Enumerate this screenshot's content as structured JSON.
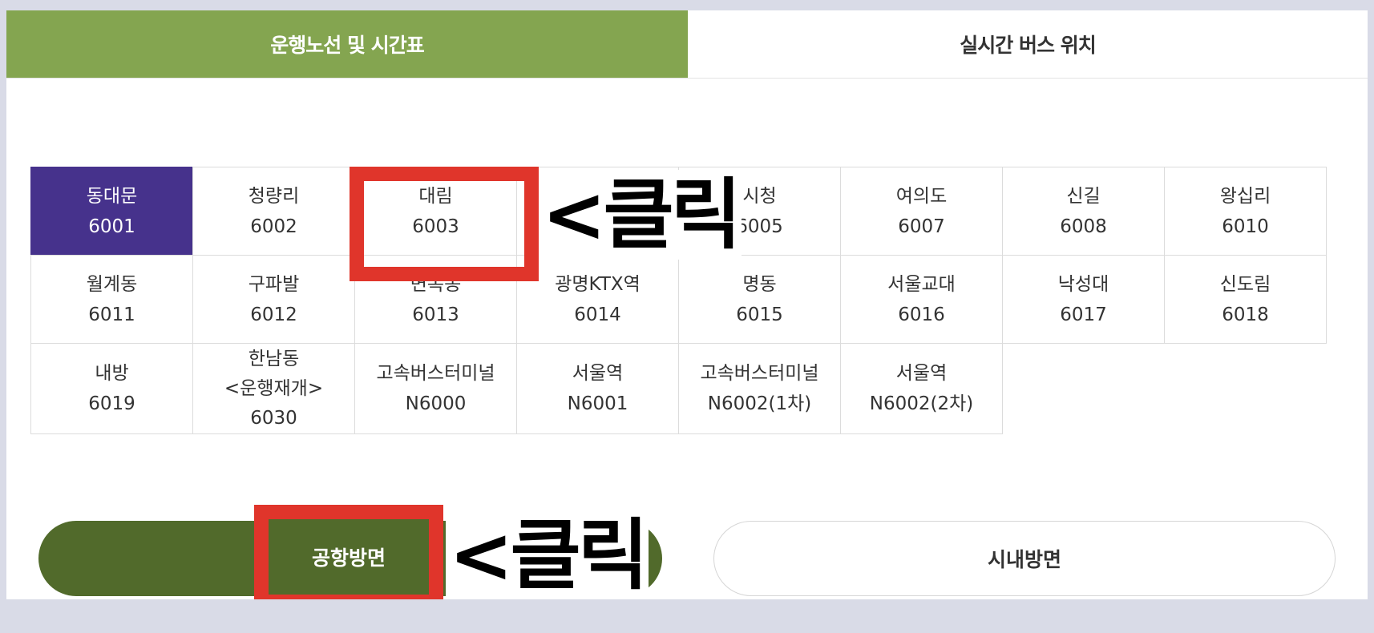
{
  "tabs": {
    "active": "운행노선 및 시간표",
    "inactive": "실시간 버스 위치"
  },
  "routes": [
    {
      "name": "동대문",
      "num": "6001"
    },
    {
      "name": "청량리",
      "num": "6002"
    },
    {
      "name": "대림",
      "num": "6003"
    },
    {
      "name": "",
      "num": ""
    },
    {
      "name": "시청",
      "num": "6005"
    },
    {
      "name": "여의도",
      "num": "6007"
    },
    {
      "name": "신길",
      "num": "6008"
    },
    {
      "name": "왕십리",
      "num": "6010"
    },
    {
      "name": "월계동",
      "num": "6011"
    },
    {
      "name": "구파발",
      "num": "6012"
    },
    {
      "name": "면목동",
      "num": "6013"
    },
    {
      "name": "광명KTX역",
      "num": "6014"
    },
    {
      "name": "명동",
      "num": "6015"
    },
    {
      "name": "서울교대",
      "num": "6016"
    },
    {
      "name": "낙성대",
      "num": "6017"
    },
    {
      "name": "신도림",
      "num": "6018"
    },
    {
      "name": "내방",
      "num": "6019"
    },
    {
      "name": "한남동",
      "extra": "<운행재개>",
      "num": "6030"
    },
    {
      "name": "고속버스터미널",
      "num": "N6000"
    },
    {
      "name": "서울역",
      "num": "N6001"
    },
    {
      "name": "고속버스터미널",
      "num": "N6002(1차)"
    },
    {
      "name": "서울역",
      "num": "N6002(2차)"
    }
  ],
  "directions": {
    "airport": "공항방면",
    "city": "시내방면"
  },
  "annotations": {
    "click_1": "<클릭",
    "click_2": "<클릭"
  },
  "colors": {
    "tab_active": "#84a550",
    "route_active": "#46328c",
    "direction_active": "#516a2b",
    "highlight": "#e0352b"
  }
}
